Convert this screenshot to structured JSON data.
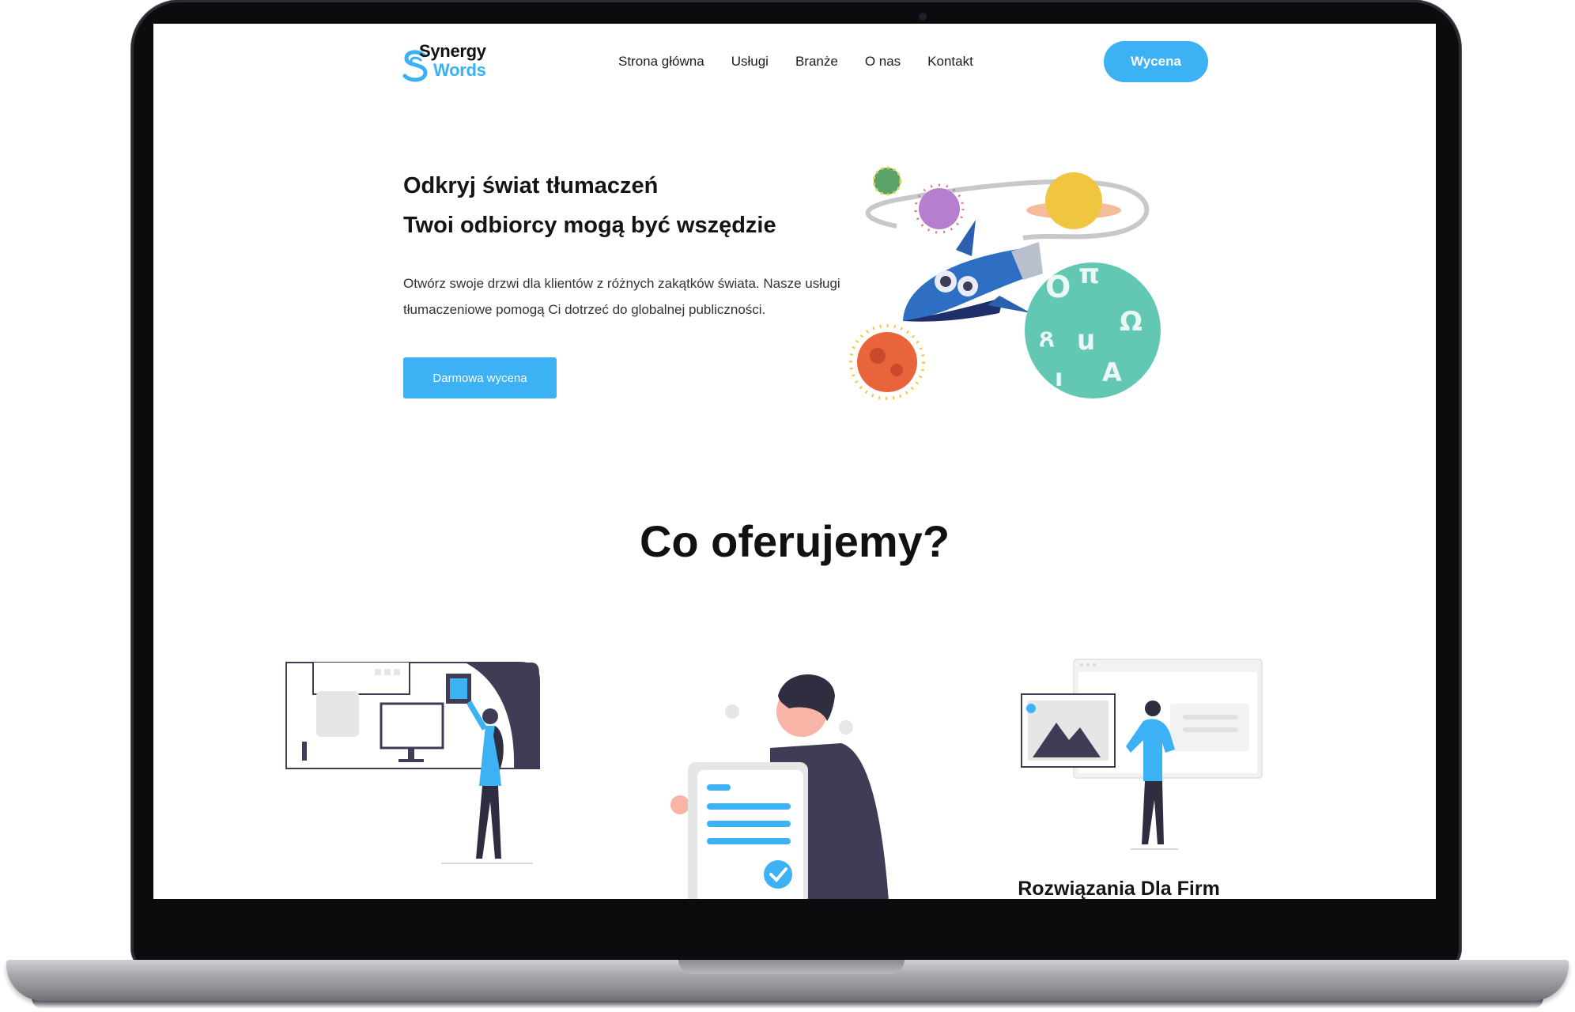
{
  "header": {
    "logo_line1": "Synergy",
    "logo_line2": "Words",
    "nav": [
      "Strona główna",
      "Usługi",
      "Branże",
      "O nas",
      "Kontakt"
    ],
    "cta": "Wycena"
  },
  "hero": {
    "title_line1": "Odkryj świat tłumaczeń",
    "title_line2": "Twoi odbiorcy mogą być wszędzie",
    "text": "Otwórz swoje drzwi dla klientów z różnych zakątków świata. Nasze usługi tłumaczeniowe pomogą Ci dotrzeć do globalnej publiczności.",
    "button": "Darmowa wycena"
  },
  "offer": {
    "title": "Co oferujemy?",
    "cards": [
      {
        "title": ""
      },
      {
        "title": ""
      },
      {
        "title": "Rozwiązania Dla Firm"
      }
    ]
  },
  "colors": {
    "accent": "#3cb1f3",
    "text_dark": "#141414",
    "illustration_dark": "#3f3d56",
    "illustration_skin": "#f7b4a7"
  }
}
